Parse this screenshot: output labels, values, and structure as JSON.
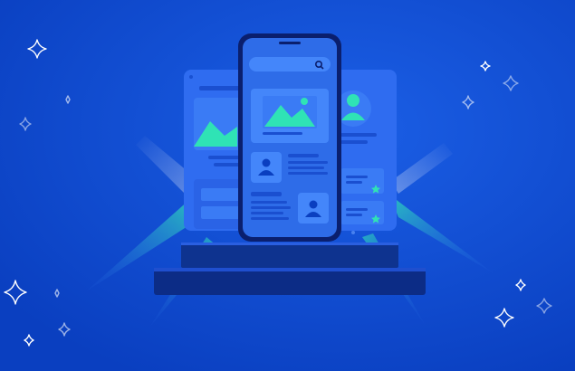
{
  "illustration": {
    "subject": "responsive-app-mockup",
    "colors": {
      "background": "#0a3fc0",
      "background_light": "#1b5fe6",
      "screen": "#2f6cf0",
      "panel": "#3a7bf5",
      "accent": "#2fe3b5",
      "phone_frame": "#0a1f6e",
      "pedestal": "#0c2c86"
    },
    "icons": [
      "search-icon",
      "image-icon",
      "user-icon",
      "star-icon",
      "sparkle-icon"
    ]
  }
}
